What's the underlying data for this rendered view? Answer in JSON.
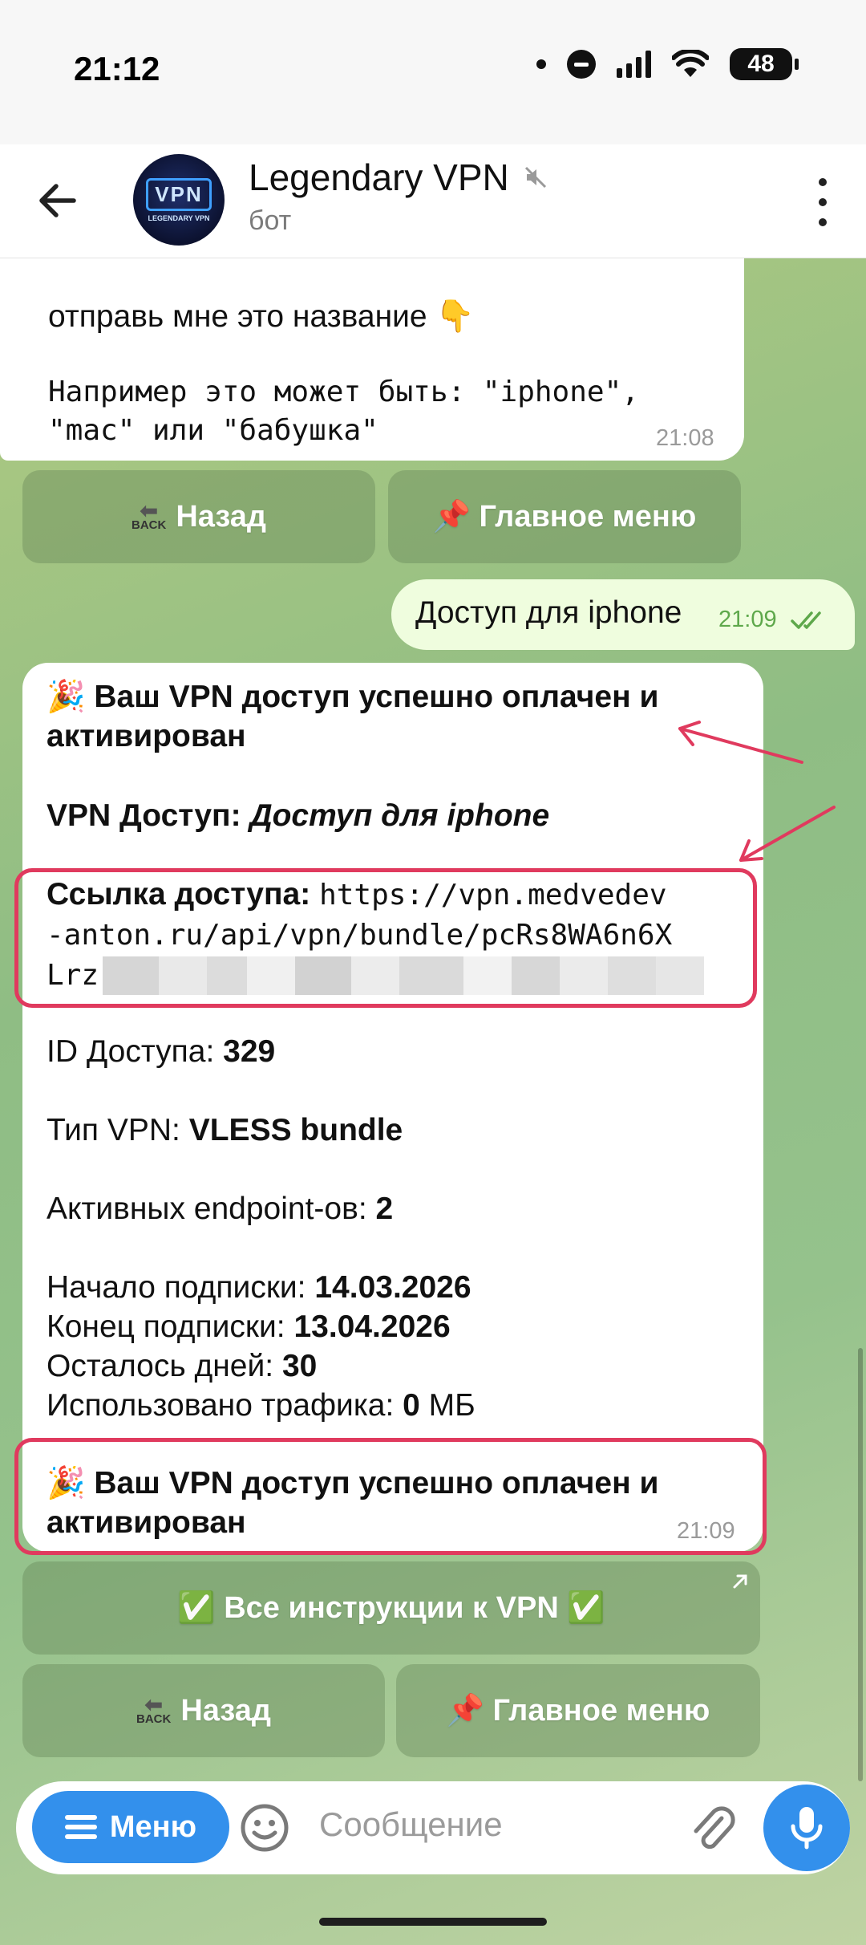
{
  "status_bar": {
    "time": "21:12",
    "battery": "48"
  },
  "header": {
    "title": "Legendary VPN",
    "subtitle": "бот",
    "avatar_main": "VPN",
    "avatar_sub": "LEGENDARY VPN"
  },
  "message_prev": {
    "line1": "отправь мне это название 👇",
    "line2": "Например это может быть: \"iphone\",",
    "line3": "\"mac\" или \"бабушка\"",
    "time": "21:08"
  },
  "keyboard_top": {
    "back": "Назад",
    "back_icon_label": "BACK",
    "main_menu": "📌 Главное меню"
  },
  "outgoing": {
    "text": "Доступ для iphone",
    "time": "21:09"
  },
  "message_main": {
    "title": "🎉 Ваш VPN доступ успешно оплачен и",
    "title2": "активирован",
    "access_label": "VPN Доступ: ",
    "access_value": "Доступ для iphone",
    "link_label": "Ссылка доступа: ",
    "link_line1": "https://vpn.medvedev",
    "link_line2": "-anton.ru/api/vpn/bundle/pcRs8WA6n6X",
    "link_line3": "Lrz",
    "id_label": "ID Доступа: ",
    "id_value": "329",
    "type_label": "Тип VPN: ",
    "type_value": "VLESS bundle",
    "endpoints_label": "Активных endpoint-ов: ",
    "endpoints_value": "2",
    "start_label": "Начало подписки: ",
    "start_value": "14.03.2026",
    "end_label": "Конец подписки: ",
    "end_value": "13.04.2026",
    "days_label": "Осталось дней: ",
    "days_value": "30",
    "traffic_label": "Использовано трафика: ",
    "traffic_value": "0",
    "traffic_unit": " МБ",
    "footer_title": "🎉 Ваш VPN доступ успешно оплачен и",
    "footer_title2": "активирован",
    "time": "21:09"
  },
  "keyboard_bottom": {
    "instructions": "✅ Все инструкции к VPN ✅",
    "back": "Назад",
    "back_icon_label": "BACK",
    "main_menu": "📌 Главное меню"
  },
  "input": {
    "menu_label": "Меню",
    "placeholder": "Сообщение"
  },
  "colors": {
    "accent": "#3390ec",
    "highlight": "#e03a5e",
    "outgoing_bg": "#effdde",
    "read_check": "#5ea84b"
  }
}
